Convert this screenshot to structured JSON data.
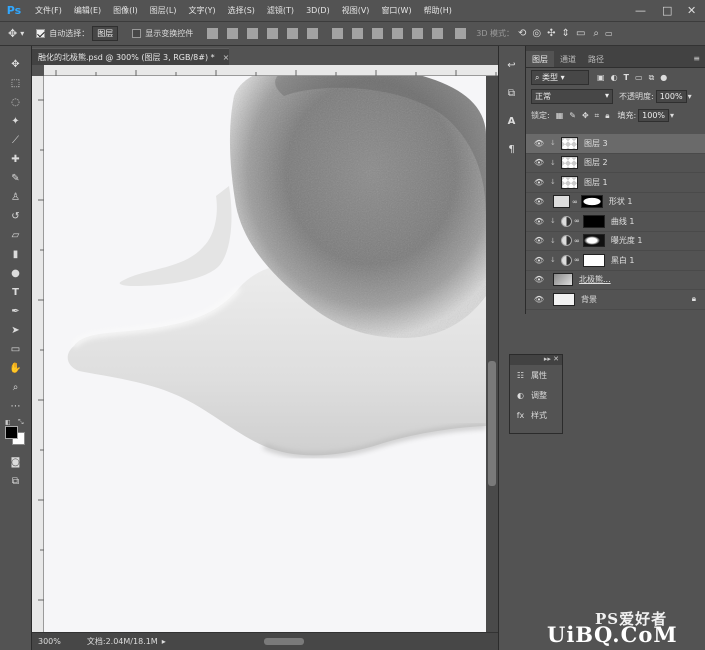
{
  "menubar": {
    "logo": "Ps",
    "items": [
      "文件(F)",
      "编辑(E)",
      "图像(I)",
      "图层(L)",
      "文字(Y)",
      "选择(S)",
      "滤镜(T)",
      "3D(D)",
      "视图(V)",
      "窗口(W)",
      "帮助(H)"
    ],
    "minimize": "—",
    "maximize": "□",
    "close": "✕"
  },
  "options": {
    "auto_select_label": "自动选择：",
    "auto_select_value": "图层",
    "show_transform_label": "显示变换控件",
    "mode_3d_label": "3D 模式："
  },
  "document": {
    "tab_title": "融化的北极熊.psd @ 300% (图层 3, RGB/8#) *",
    "tab_close": "×",
    "zoom": "300%",
    "doc_info": "文档:2.04M/18.1M"
  },
  "layers_panel": {
    "tabs": [
      "图层",
      "通道",
      "路径"
    ],
    "filter_kind": "类型",
    "blend_mode": "正常",
    "opacity_label": "不透明度:",
    "opacity_value": "100%",
    "lock_label": "锁定:",
    "fill_label": "填充:",
    "fill_value": "100%",
    "layers": [
      {
        "name": "图层 3",
        "selected": true
      },
      {
        "name": "图层 2",
        "selected": false
      },
      {
        "name": "图层 1",
        "selected": false
      },
      {
        "name": "形状 1",
        "selected": false
      },
      {
        "name": "曲线 1",
        "selected": false
      },
      {
        "name": "曝光度 1",
        "selected": false
      },
      {
        "name": "黑白 1",
        "selected": false
      },
      {
        "name": "北极熊...",
        "selected": false
      },
      {
        "name": "背景",
        "selected": false
      }
    ]
  },
  "float_panel": {
    "header": "▸▸ ✕",
    "items": [
      "属性",
      "调整",
      "样式"
    ]
  },
  "watermark": {
    "top": "PS爱好者",
    "bottom": "UiBQ.CoM"
  }
}
